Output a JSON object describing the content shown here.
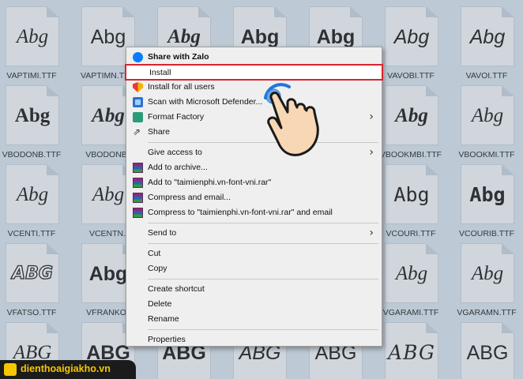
{
  "files": [
    {
      "sample": "Abg",
      "name": "VAPTIMI.TTF",
      "style": "f-serif-it"
    },
    {
      "sample": "Abg",
      "name": "VAPTIMN.TTF",
      "style": "f-sans"
    },
    {
      "sample": "Abg",
      "name": "",
      "style": "f-serif-it-b"
    },
    {
      "sample": "Abg",
      "name": "",
      "style": "f-sans-b"
    },
    {
      "sample": "Abg",
      "name": "",
      "style": "f-sans-b"
    },
    {
      "sample": "Abg",
      "name": "VAVOBI.TTF",
      "style": "f-sans-it"
    },
    {
      "sample": "Abg",
      "name": "VAVOI.TTF",
      "style": "f-sans-it"
    },
    {
      "sample": "Abg",
      "name": "VBODONB.TTF",
      "style": "f-serif-b"
    },
    {
      "sample": "Abg",
      "name": "VBODONB.",
      "style": "f-serif-it-b"
    },
    {
      "sample": "",
      "name": "",
      "style": "f-sans"
    },
    {
      "sample": "",
      "name": "",
      "style": "f-sans"
    },
    {
      "sample": "",
      "name": "",
      "style": "f-sans"
    },
    {
      "sample": "Abg",
      "name": "VBOOKMBI.TTF",
      "style": "f-serif-it-b"
    },
    {
      "sample": "Abg",
      "name": "VBOOKMI.TTF",
      "style": "f-serif-it"
    },
    {
      "sample": "Abg",
      "name": "VCENTI.TTF",
      "style": "f-serif-it"
    },
    {
      "sample": "Abg",
      "name": "VCENTN.",
      "style": "f-serif-it"
    },
    {
      "sample": "",
      "name": "",
      "style": "f-sans"
    },
    {
      "sample": "",
      "name": "",
      "style": "f-sans"
    },
    {
      "sample": "",
      "name": "",
      "style": "f-sans"
    },
    {
      "sample": "Abg",
      "name": "VCOURI.TTF",
      "style": "f-mono"
    },
    {
      "sample": "Abg",
      "name": "VCOURIB.TTF",
      "style": "f-mono-b"
    },
    {
      "sample": "ABG",
      "name": "VFATSO.TTF",
      "style": "f-outline"
    },
    {
      "sample": "Abg",
      "name": "VFRANKO.",
      "style": "f-sans-b"
    },
    {
      "sample": "",
      "name": "",
      "style": "f-sans"
    },
    {
      "sample": "",
      "name": "",
      "style": "f-sans"
    },
    {
      "sample": "",
      "name": "",
      "style": "f-sans"
    },
    {
      "sample": "Abg",
      "name": "VGARAMI.TTF",
      "style": "f-serif-it"
    },
    {
      "sample": "Abg",
      "name": "VGARAMN.TTF",
      "style": "f-serif-it"
    },
    {
      "sample": "ABG",
      "name": "",
      "style": "f-serif-it"
    },
    {
      "sample": "ABG",
      "name": "",
      "style": "f-sans-b"
    },
    {
      "sample": "ABG",
      "name": "",
      "style": "f-sans-b"
    },
    {
      "sample": "ABG",
      "name": "",
      "style": "f-sans-it"
    },
    {
      "sample": "ABG",
      "name": "",
      "style": "f-sans"
    },
    {
      "sample": "ABG",
      "name": "",
      "style": "f-script"
    },
    {
      "sample": "ABG",
      "name": "",
      "style": "f-sans"
    }
  ],
  "menu": {
    "items": [
      {
        "type": "item",
        "label": "Share with Zalo",
        "icon": "zalo-icon",
        "bold": true
      },
      {
        "type": "item",
        "label": "Install",
        "icon": "",
        "highlight": true
      },
      {
        "type": "item",
        "label": "Install for all users",
        "icon": "shield-icon"
      },
      {
        "type": "item",
        "label": "Scan with Microsoft Defender...",
        "icon": "defender-icon"
      },
      {
        "type": "item",
        "label": "Format Factory",
        "icon": "format-factory-icon",
        "submenu": true
      },
      {
        "type": "item",
        "label": "Share",
        "icon": "share-icon"
      },
      {
        "type": "sep"
      },
      {
        "type": "item",
        "label": "Give access to",
        "icon": "",
        "submenu": true
      },
      {
        "type": "item",
        "label": "Add to archive...",
        "icon": "winrar-icon"
      },
      {
        "type": "item",
        "label": "Add to \"taimienphi.vn-font-vni.rar\"",
        "icon": "winrar-icon"
      },
      {
        "type": "item",
        "label": "Compress and email...",
        "icon": "winrar-icon"
      },
      {
        "type": "item",
        "label": "Compress to \"taimienphi.vn-font-vni.rar\" and email",
        "icon": "winrar-icon"
      },
      {
        "type": "sep"
      },
      {
        "type": "item",
        "label": "Send to",
        "icon": "",
        "submenu": true
      },
      {
        "type": "sep"
      },
      {
        "type": "item",
        "label": "Cut",
        "icon": ""
      },
      {
        "type": "item",
        "label": "Copy",
        "icon": ""
      },
      {
        "type": "sep"
      },
      {
        "type": "item",
        "label": "Create shortcut",
        "icon": ""
      },
      {
        "type": "item",
        "label": "Delete",
        "icon": ""
      },
      {
        "type": "item",
        "label": "Rename",
        "icon": ""
      },
      {
        "type": "sep"
      },
      {
        "type": "item",
        "label": "Properties",
        "icon": ""
      }
    ],
    "submenu_arrow": "›"
  },
  "watermark": {
    "text": "dienthoaigiakho.vn",
    "color": "#f7c600"
  }
}
